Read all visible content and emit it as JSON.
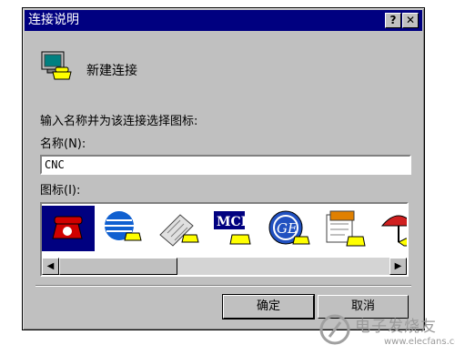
{
  "dialog": {
    "title": "连接说明",
    "help_btn": "?",
    "close_btn": "✕",
    "connection_label": "新建连接",
    "instruction": "输入名称并为该连接选择图标:",
    "name_label": "名称(N):",
    "name_value": "CNC",
    "icon_label": "图标(I):",
    "icons": [
      "red-phone-icon",
      "globe-phone-icon",
      "fax-phone-icon",
      "mci-phone-icon",
      "ge-phone-icon",
      "folder-phone-icon",
      "umbrella-phone-icon"
    ],
    "scroll_left": "◀",
    "scroll_right": "▶",
    "ok_label": "确定",
    "cancel_label": "取消"
  },
  "watermark": {
    "text": "电子发烧友",
    "url": "www.elecfans.com"
  },
  "colors": {
    "titlebar": "#000080",
    "face": "#c0c0c0",
    "selection": "#000080"
  }
}
